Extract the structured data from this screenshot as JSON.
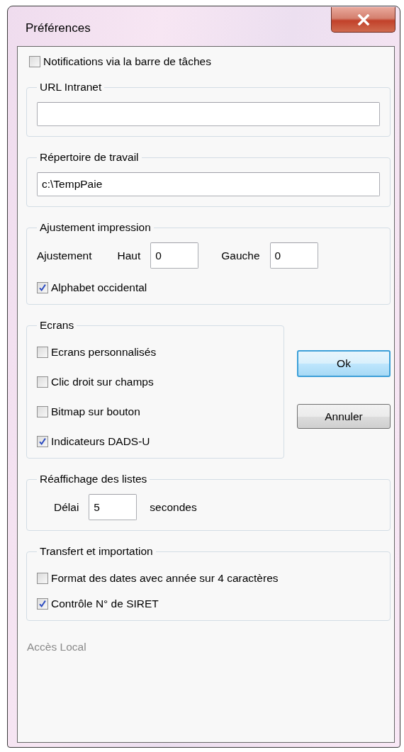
{
  "window": {
    "title": "Préférences"
  },
  "notifications": {
    "label": "Notifications via la barre de tâches",
    "checked": false
  },
  "groups": [
    {
      "kind": "panel",
      "title": "URL Intranet",
      "rows": [
        [
          {
            "kind": "wide-field"
          }
        ]
      ]
    },
    {
      "kind": "panel",
      "title": "Répertoire de travail",
      "rows": [
        [
          {
            "kind": "wide-field",
            "value": "c:\\TempPaie"
          }
        ]
      ]
    },
    {
      "kind": "panel",
      "title": "Ajustement impression",
      "rows": [
        [
          {
            "kind": "label",
            "text": "Ajustement"
          },
          {
            "kind": "label",
            "text": "Haut"
          },
          {
            "kind": "field",
            "value": "0"
          },
          {
            "kind": "label",
            "text": "Gauche"
          },
          {
            "kind": "field",
            "value": "0"
          }
        ],
        [
          {
            "kind": "checkbox",
            "label": "Alphabet occidental",
            "checked": true
          }
        ]
      ]
    },
    {
      "kind": "with-buttons",
      "title": "Ecrans",
      "rows": [
        [
          {
            "kind": "checkbox",
            "label": "Ecrans personnalisés",
            "checked": false
          }
        ],
        [
          {
            "kind": "checkbox",
            "label": "Clic droit sur champs",
            "checked": false
          }
        ],
        [
          {
            "kind": "checkbox",
            "label": "Bitmap sur bouton",
            "checked": false
          }
        ],
        [
          {
            "kind": "checkbox",
            "label": "Indicateurs DADS-U",
            "checked": true
          }
        ]
      ]
    },
    {
      "kind": "panel",
      "title": "Réaffichage des listes",
      "rows": [
        [
          {
            "kind": "label",
            "text": "Délai"
          },
          {
            "kind": "field",
            "value": "5"
          },
          {
            "kind": "label",
            "text": "secondes"
          }
        ]
      ]
    },
    {
      "kind": "panel",
      "title": "Transfert et importation",
      "rows": [
        [
          {
            "kind": "checkbox",
            "label": "Format des dates avec année sur 4 caractères",
            "checked": false
          }
        ],
        [
          {
            "kind": "checkbox",
            "label": "Contrôle N° de SIRET",
            "checked": true
          }
        ]
      ]
    }
  ],
  "buttons": [
    {
      "label": "Ok",
      "default": true
    },
    {
      "label": "Annuler",
      "default": false
    }
  ],
  "status": "Accès Local"
}
